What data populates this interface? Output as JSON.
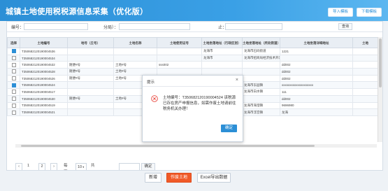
{
  "header": {
    "title": "城镇土地使用税税源信息采集（优化版）",
    "import_btn": "导入模板",
    "download_btn": "下载模板"
  },
  "filter": {
    "label1": "编号：",
    "label2": "分局）：",
    "label3": "止：",
    "query_btn": "查询"
  },
  "table": {
    "headers": [
      "选择",
      "土地编号",
      "地号（丘号）",
      "土地名称",
      "土地使用证号",
      "土地坐落地址（行政区划）",
      "土地坐落地址（所处街道）",
      "土地坐落详细地址",
      "土地"
    ],
    "rows": [
      {
        "checked": true,
        "cells": [
          "T350682120190004536",
          "",
          "",
          "",
          "龙海市",
          "龙海市石码街道",
          "1221"
        ]
      },
      {
        "checked": false,
        "cells": [
          "T350682120190004534",
          "",
          "",
          "",
          "龙海市",
          "龙海市招商局经济技术开发区",
          ""
        ]
      },
      {
        "checked": false,
        "cells": [
          "T350682120190004532",
          "随便#号",
          "土地#号",
          "sss002",
          "",
          "",
          "dd002"
        ]
      },
      {
        "checked": false,
        "cells": [
          "T350682120190004528",
          "随便#号",
          "土地#号",
          "",
          "",
          "",
          "dd002"
        ]
      },
      {
        "checked": false,
        "cells": [
          "T350682120190004526",
          "随便#号",
          "土地#号",
          "",
          "",
          "",
          "dd002"
        ]
      },
      {
        "checked": true,
        "cells": [
          "T350682120190004524",
          "",
          "",
          "",
          "",
          "龙海市东园镇",
          "xxxxxxxxxxxxxxxxxxxx"
        ]
      },
      {
        "checked": false,
        "cells": [
          "T350682120190004517",
          "",
          "",
          "",
          "",
          "龙海市白水镇",
          "111"
        ]
      },
      {
        "checked": false,
        "cells": [
          "T350682120190004530",
          "随便#号",
          "土地#号",
          "",
          "",
          "",
          "dd002"
        ]
      },
      {
        "checked": false,
        "cells": [
          "T350682120190004519",
          "",
          "",
          "",
          "",
          "龙海市海澄镇",
          "9696980"
        ]
      },
      {
        "checked": false,
        "cells": [
          "T350682120190004521",
          "",
          "",
          "",
          "",
          "龙海市浮宫镇",
          "龙海"
        ]
      }
    ]
  },
  "pager": {
    "page_current": "1",
    "page_next": "2",
    "per_page_label": "每页",
    "per_page_value": "10",
    "total": "共18条 跳转至",
    "go_btn": "确定"
  },
  "actions": {
    "new_btn": "新增",
    "void_btn": "作废土地",
    "excel_btn": "Excel导出数据"
  },
  "dialog": {
    "title": "提示",
    "close": "×",
    "message": "土地编号：T350682120190004524 该税源已存在房产申报信息，如需作废土地请前往税务机关办理！",
    "ok": "确定"
  }
}
